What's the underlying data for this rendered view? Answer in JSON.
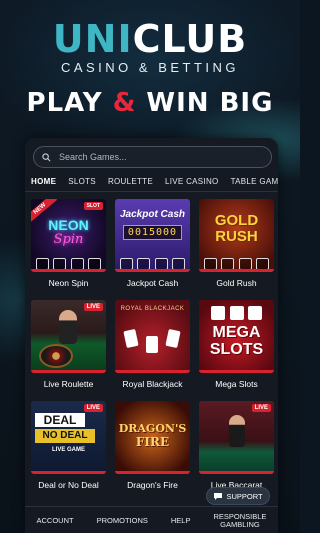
{
  "brand": {
    "part1": "UNI",
    "part2": "CLUB",
    "subtitle": "CASINO & BETTING"
  },
  "tagline": {
    "part1": "PLAY ",
    "amp": "&",
    "part2": " WIN BIG"
  },
  "search": {
    "placeholder": "Search Games..."
  },
  "tabs": [
    {
      "label": "HOME",
      "active": true
    },
    {
      "label": "SLOTS"
    },
    {
      "label": "ROULETTE"
    },
    {
      "label": "LIVE CASINO"
    },
    {
      "label": "TABLE GAMES"
    }
  ],
  "games": [
    {
      "title": "Neon Spin",
      "art": [
        "NEON",
        "Spin"
      ],
      "badge_new": "NEW",
      "badge": "SLOT"
    },
    {
      "title": "Jackpot Cash",
      "art": [
        "Jackpot Cash",
        "0015000"
      ]
    },
    {
      "title": "Gold Rush",
      "art": [
        "GOLD",
        "RUSH"
      ]
    },
    {
      "title": "Live Roulette",
      "badge": "LIVE"
    },
    {
      "title": "Royal Blackjack",
      "art": [
        "ROYAL BLACKJACK"
      ]
    },
    {
      "title": "Mega Slots",
      "art": [
        "MEGA",
        "SLOTS"
      ]
    },
    {
      "title": "Deal or No Deal",
      "art": [
        "DEAL",
        "NO DEAL",
        "LIVE GAME"
      ],
      "badge": "LIVE"
    },
    {
      "title": "Dragon's Fire",
      "art": [
        "DRAGON'S",
        "FIRE"
      ]
    },
    {
      "title": "Live Baccarat",
      "badge": "LIVE"
    }
  ],
  "bottom_nav": {
    "account": "ACCOUNT",
    "promotions": "PROMOTIONS",
    "help": "HELP",
    "responsible_1": "RESPONSIBLE",
    "responsible_2": "GAMBLING"
  },
  "support": {
    "label": "SUPPORT"
  },
  "colors": {
    "accent": "#3fb6c4",
    "red": "#d8222f",
    "panel": "#151a22"
  }
}
